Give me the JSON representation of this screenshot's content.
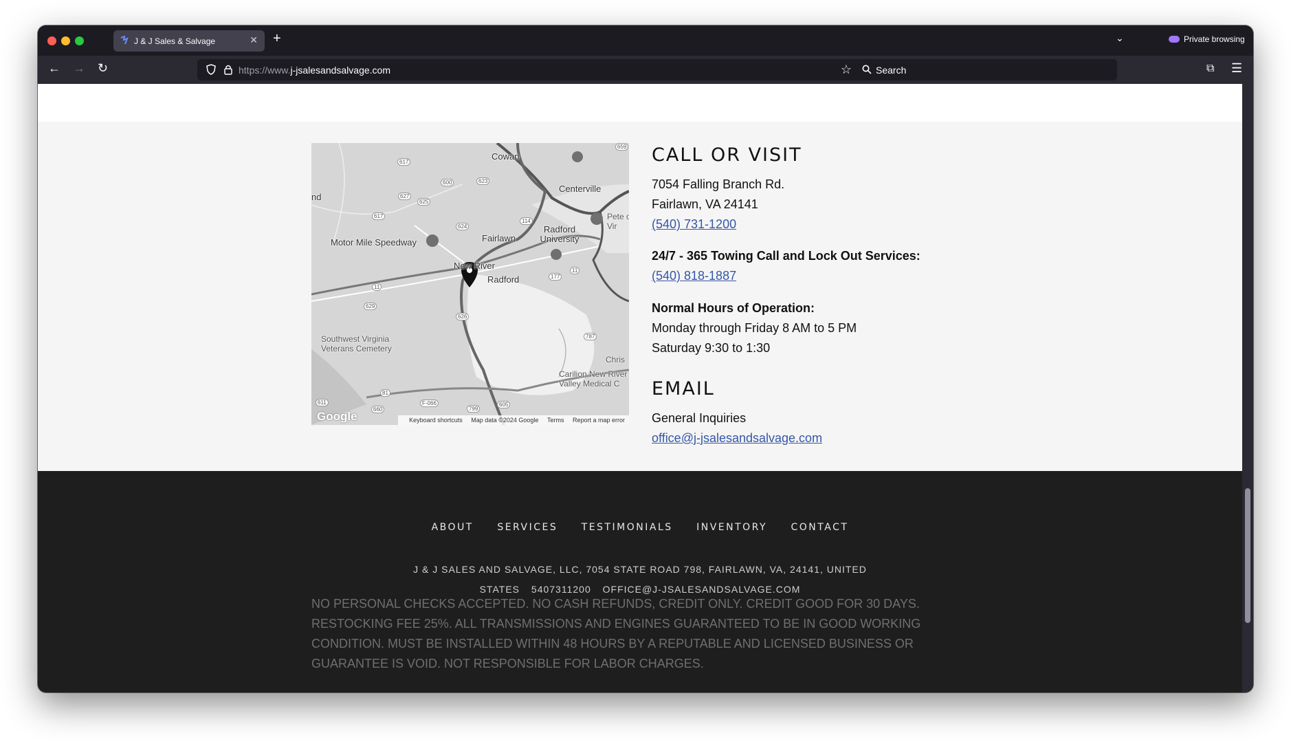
{
  "browser": {
    "tab_title": "J & J Sales & Salvage",
    "url_prefix": "https://www.",
    "url_domain": "j-jsalesandsalvage.com",
    "search_placeholder": "Search",
    "private_label": "Private browsing"
  },
  "contact": {
    "heading": "CALL OR VISIT",
    "address_line1": "7054 Falling Branch Rd.",
    "address_line2": "Fairlawn, VA 24141",
    "phone": "(540) 731-1200",
    "towing_label": "24/7 - 365 Towing Call and Lock Out Services:",
    "towing_phone": "(540) 818-1887",
    "hours_label": "Normal Hours of Operation:",
    "hours_weekday": "Monday through Friday 8 AM to 5 PM",
    "hours_saturday": "Saturday 9:30 to 1:30",
    "email_heading": "EMAIL",
    "email_label": "General Inquiries",
    "email": "office@j-jsalesandsalvage.com"
  },
  "map": {
    "labels": {
      "cowan": "Cowan",
      "centerville": "Centerville",
      "radford_university": "Radford University",
      "fairlawn": "Fairlawn",
      "motor_mile": "Motor Mile Speedway",
      "new_river": "New River",
      "radford": "Radford",
      "sw_va_cemetery": "Southwest Virginia Veterans Cemetery",
      "carilion": "Carilion New River Valley Medical C",
      "nd": "nd",
      "pete": "Pete of Vir",
      "chris": "Chris"
    },
    "shields": [
      "617",
      "600",
      "623",
      "627",
      "625",
      "617",
      "624",
      "114",
      "11",
      "11",
      "177",
      "626",
      "629",
      "787",
      "81",
      "660",
      "F-066",
      "799",
      "605",
      "611",
      "659"
    ],
    "footer": {
      "keyboard": "Keyboard shortcuts",
      "map_data": "Map data ©2024 Google",
      "terms": "Terms",
      "report": "Report a map error"
    },
    "logo": "Google"
  },
  "footer": {
    "nav": [
      "ABOUT",
      "SERVICES",
      "TESTIMONIALS",
      "INVENTORY",
      "CONTACT"
    ],
    "address_line1": "J & J SALES AND SALVAGE, LLC, 7054 STATE ROAD 798, FAIRLAWN, VA, 24141, UNITED",
    "address_line2_a": "STATES",
    "address_line2_b": "5407311200",
    "address_line2_c": "OFFICE@J-JSALESANDSALVAGE.COM",
    "notice": "NO PERSONAL CHECKS ACCEPTED. NO CASH REFUNDS, CREDIT ONLY. CREDIT GOOD FOR 30 DAYS. RESTOCKING FEE 25%. ALL TRANSMISSIONS AND ENGINES GUARANTEED TO BE IN GOOD WORKING CONDITION. MUST BE INSTALLED WITHIN 48 HOURS BY A REPUTABLE AND LICENSED BUSINESS OR GUARANTEE IS VOID. NOT RESPONSIBLE FOR LABOR CHARGES."
  }
}
